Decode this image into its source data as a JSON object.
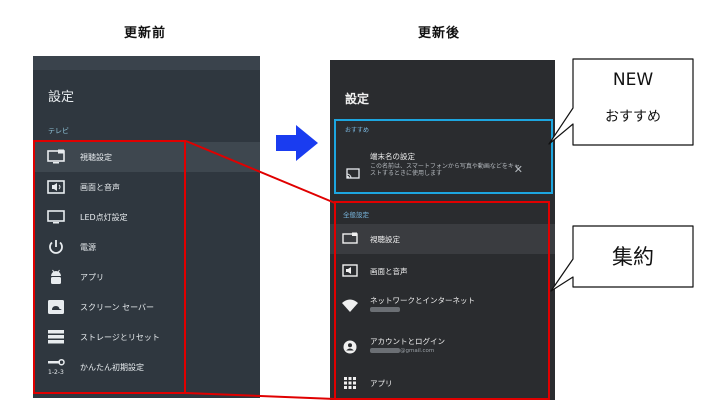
{
  "captions": {
    "before": "更新前",
    "after": "更新後"
  },
  "before": {
    "title": "設定",
    "section": "テレビ",
    "items": [
      {
        "label": "視聴設定",
        "icon": "tv-monitor-icon"
      },
      {
        "label": "画面と音声",
        "icon": "picture-sound-icon"
      },
      {
        "label": "LED点灯設定",
        "icon": "monitor-icon"
      },
      {
        "label": "電源",
        "icon": "power-icon"
      },
      {
        "label": "アプリ",
        "icon": "android-icon"
      },
      {
        "label": "スクリーン セーバー",
        "icon": "screensaver-icon"
      },
      {
        "label": "ストレージとリセット",
        "icon": "storage-icon"
      },
      {
        "label": "かんたん初期設定",
        "icon": "setup-wrench-icon"
      }
    ]
  },
  "after": {
    "title": "設定",
    "recommend": {
      "label": "おすすめ",
      "title": "端末名の設定",
      "desc": "この名前は、スマートフォンから写真や動画などをキャストするときに使用します",
      "close": "✕"
    },
    "general_label": "全般設定",
    "items": [
      {
        "label": "視聴設定",
        "sub": "",
        "icon": "tv-monitor-icon"
      },
      {
        "label": "画面と音声",
        "sub": "",
        "icon": "picture-sound-icon"
      },
      {
        "label": "ネットワークとインターネット",
        "sub": "",
        "icon": "wifi-icon"
      },
      {
        "label": "アカウントとログイン",
        "sub": "@gmail.com",
        "icon": "account-icon"
      },
      {
        "label": "アプリ",
        "sub": "",
        "icon": "apps-grid-icon"
      }
    ]
  },
  "callouts": {
    "new_line1": "NEW",
    "new_line2": "おすすめ",
    "consolidate": "集約"
  },
  "colors": {
    "highlight_red": "#e00000",
    "highlight_blue": "#1da6e0",
    "arrow_blue": "#1a3cf0"
  }
}
